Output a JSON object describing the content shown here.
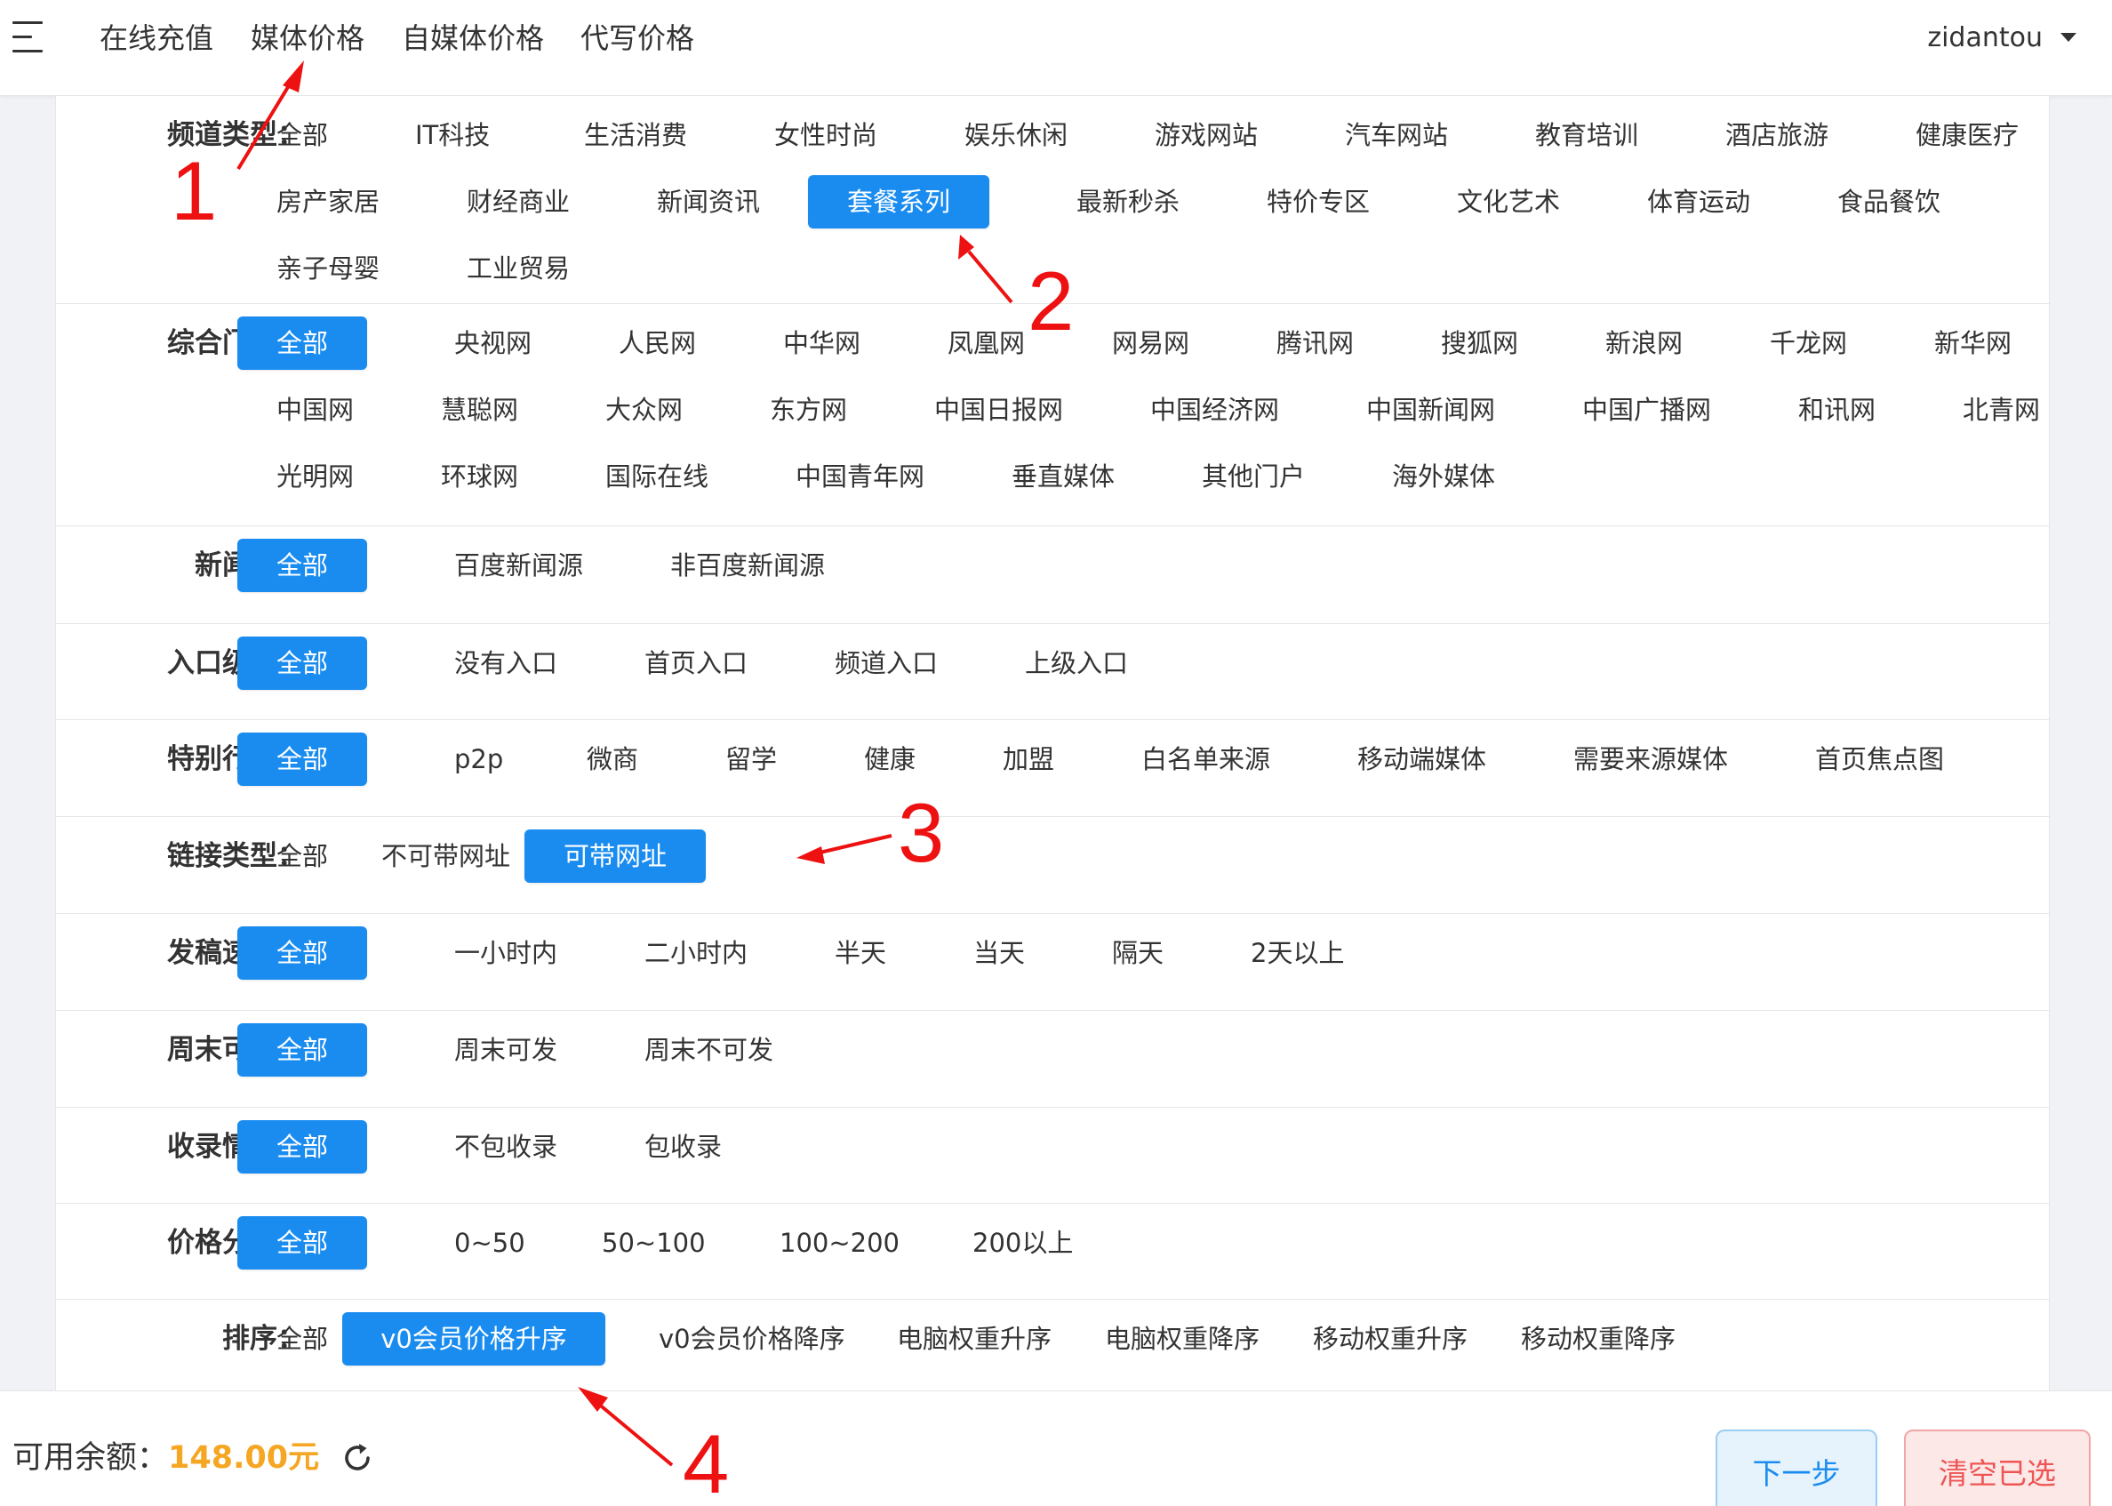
{
  "nav": {
    "menu_icon": "hamburger-menu-icon",
    "items": [
      "在线充值",
      "媒体价格",
      "自媒体价格",
      "代写价格"
    ],
    "user": "zidantou",
    "user_icon": "caret-down-icon"
  },
  "filters": [
    {
      "label": "频道类型：",
      "options": [
        "全部",
        "IT科技",
        "生活消费",
        "女性时尚",
        "娱乐休闲",
        "游戏网站",
        "汽车网站",
        "教育培训",
        "酒店旅游",
        "健康医疗",
        "房产家居",
        "财经商业",
        "新闻资讯",
        "套餐系列",
        "最新秒杀",
        "特价专区",
        "文化艺术",
        "体育运动",
        "食品餐饮",
        "亲子母婴",
        "工业贸易"
      ],
      "selected": 13
    },
    {
      "label": "综合门户：",
      "options": [
        "全部",
        "央视网",
        "人民网",
        "中华网",
        "凤凰网",
        "网易网",
        "腾讯网",
        "搜狐网",
        "新浪网",
        "千龙网",
        "新华网",
        "中国网",
        "慧聪网",
        "大众网",
        "东方网",
        "中国日报网",
        "中国经济网",
        "中国新闻网",
        "中国广播网",
        "和讯网",
        "北青网",
        "光明网",
        "环球网",
        "国际在线",
        "中国青年网",
        "垂直媒体",
        "其他门户",
        "海外媒体"
      ],
      "selected": 0
    },
    {
      "label": "新闻源：",
      "options": [
        "全部",
        "百度新闻源",
        "非百度新闻源"
      ],
      "selected": 0
    },
    {
      "label": "入口级别：",
      "options": [
        "全部",
        "没有入口",
        "首页入口",
        "频道入口",
        "上级入口"
      ],
      "selected": 0
    },
    {
      "label": "特别行业：",
      "options": [
        "全部",
        "p2p",
        "微商",
        "留学",
        "健康",
        "加盟",
        "白名单来源",
        "移动端媒体",
        "需要来源媒体",
        "首页焦点图"
      ],
      "selected": 0
    },
    {
      "label": "链接类型：",
      "options": [
        "全部",
        "不可带网址",
        "可带网址"
      ],
      "selected": 2
    },
    {
      "label": "发稿速度：",
      "options": [
        "全部",
        "一小时内",
        "二小时内",
        "半天",
        "当天",
        "隔天",
        "2天以上"
      ],
      "selected": 0
    },
    {
      "label": "周末可发：",
      "options": [
        "全部",
        "周末可发",
        "周末不可发"
      ],
      "selected": 0
    },
    {
      "label": "收录情况：",
      "options": [
        "全部",
        "不包收录",
        "包收录"
      ],
      "selected": 0
    },
    {
      "label": "价格分类：",
      "options": [
        "全部",
        "0~50",
        "50~100",
        "100~200",
        "200以上"
      ],
      "selected": 0
    },
    {
      "label": "排序：",
      "options": [
        "全部",
        "v0会员价格升序",
        "v0会员价格降序",
        "电脑权重升序",
        "电脑权重降序",
        "移动权重升序",
        "移动权重降序"
      ],
      "selected": 1
    }
  ],
  "footer": {
    "balance_label": "可用余额：",
    "balance_value": "148.00元",
    "refresh_icon": "refresh-icon",
    "next_button": "下一步",
    "clear_button": "清空已选"
  },
  "annotations": {
    "color": "#ee1111",
    "labels": [
      "1",
      "2",
      "3",
      "4"
    ]
  },
  "colors": {
    "accent": "#1a8cf0",
    "balance": "#f5a623",
    "annotation": "#ee1111"
  }
}
